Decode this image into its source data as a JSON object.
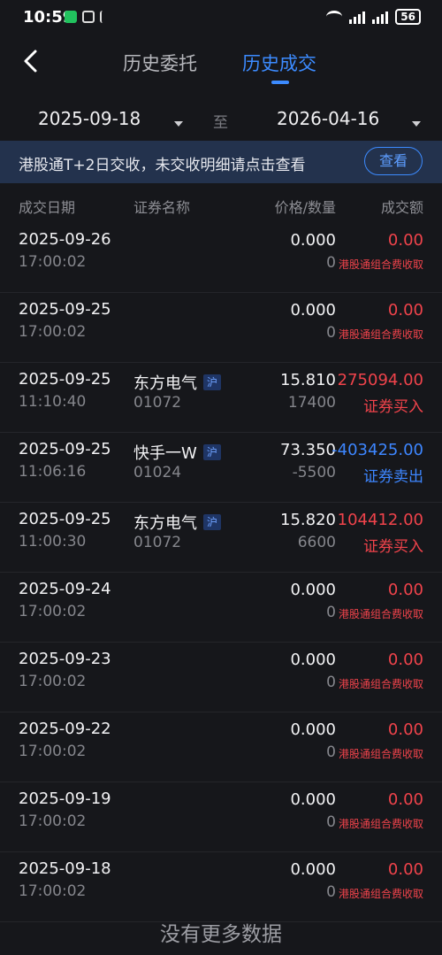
{
  "status": {
    "time": "10:59",
    "battery": "56"
  },
  "nav": {
    "tab_history_orders": "历史委托",
    "tab_history_trades": "历史成交"
  },
  "date_range": {
    "start": "2025-09-18",
    "to": "至",
    "end": "2026-04-16"
  },
  "banner": {
    "text": "港股通T+2日交收，未交收明细请点击查看",
    "button": "查看"
  },
  "columns": {
    "date": "成交日期",
    "name": "证券名称",
    "price_qty": "价格/数量",
    "amount": "成交额"
  },
  "rows": [
    {
      "date": "2025-09-26",
      "time": "17:00:02",
      "price": "0.000",
      "qty": "0",
      "amount": "0.00",
      "note": "港股通组合费收取"
    },
    {
      "date": "2025-09-25",
      "time": "17:00:02",
      "price": "0.000",
      "qty": "0",
      "amount": "0.00",
      "note": "港股通组合费收取"
    },
    {
      "date": "2025-09-25",
      "time": "11:10:40",
      "name": "东方电气",
      "market": "沪",
      "code": "01072",
      "price": "15.810",
      "qty": "17400",
      "amount": "275094.00",
      "trade_type": "证券买入"
    },
    {
      "date": "2025-09-25",
      "time": "11:06:16",
      "name": "快手一W",
      "market": "沪",
      "code": "01024",
      "price": "73.350",
      "qty": "-5500",
      "amount": "-403425.00",
      "trade_type": "证券卖出"
    },
    {
      "date": "2025-09-25",
      "time": "11:00:30",
      "name": "东方电气",
      "market": "沪",
      "code": "01072",
      "price": "15.820",
      "qty": "6600",
      "amount": "104412.00",
      "trade_type": "证券买入"
    },
    {
      "date": "2025-09-24",
      "time": "17:00:02",
      "price": "0.000",
      "qty": "0",
      "amount": "0.00",
      "note": "港股通组合费收取"
    },
    {
      "date": "2025-09-23",
      "time": "17:00:02",
      "price": "0.000",
      "qty": "0",
      "amount": "0.00",
      "note": "港股通组合费收取"
    },
    {
      "date": "2025-09-22",
      "time": "17:00:02",
      "price": "0.000",
      "qty": "0",
      "amount": "0.00",
      "note": "港股通组合费收取"
    },
    {
      "date": "2025-09-19",
      "time": "17:00:02",
      "price": "0.000",
      "qty": "0",
      "amount": "0.00",
      "note": "港股通组合费收取"
    },
    {
      "date": "2025-09-18",
      "time": "17:00:02",
      "price": "0.000",
      "qty": "0",
      "amount": "0.00",
      "note": "港股通组合费收取"
    }
  ],
  "footer": {
    "no_more": "没有更多数据"
  },
  "colors": {
    "accent": "#3c8bff",
    "buy_red": "#f0434b",
    "sell_blue": "#3d86ff",
    "background": "#16171b"
  }
}
